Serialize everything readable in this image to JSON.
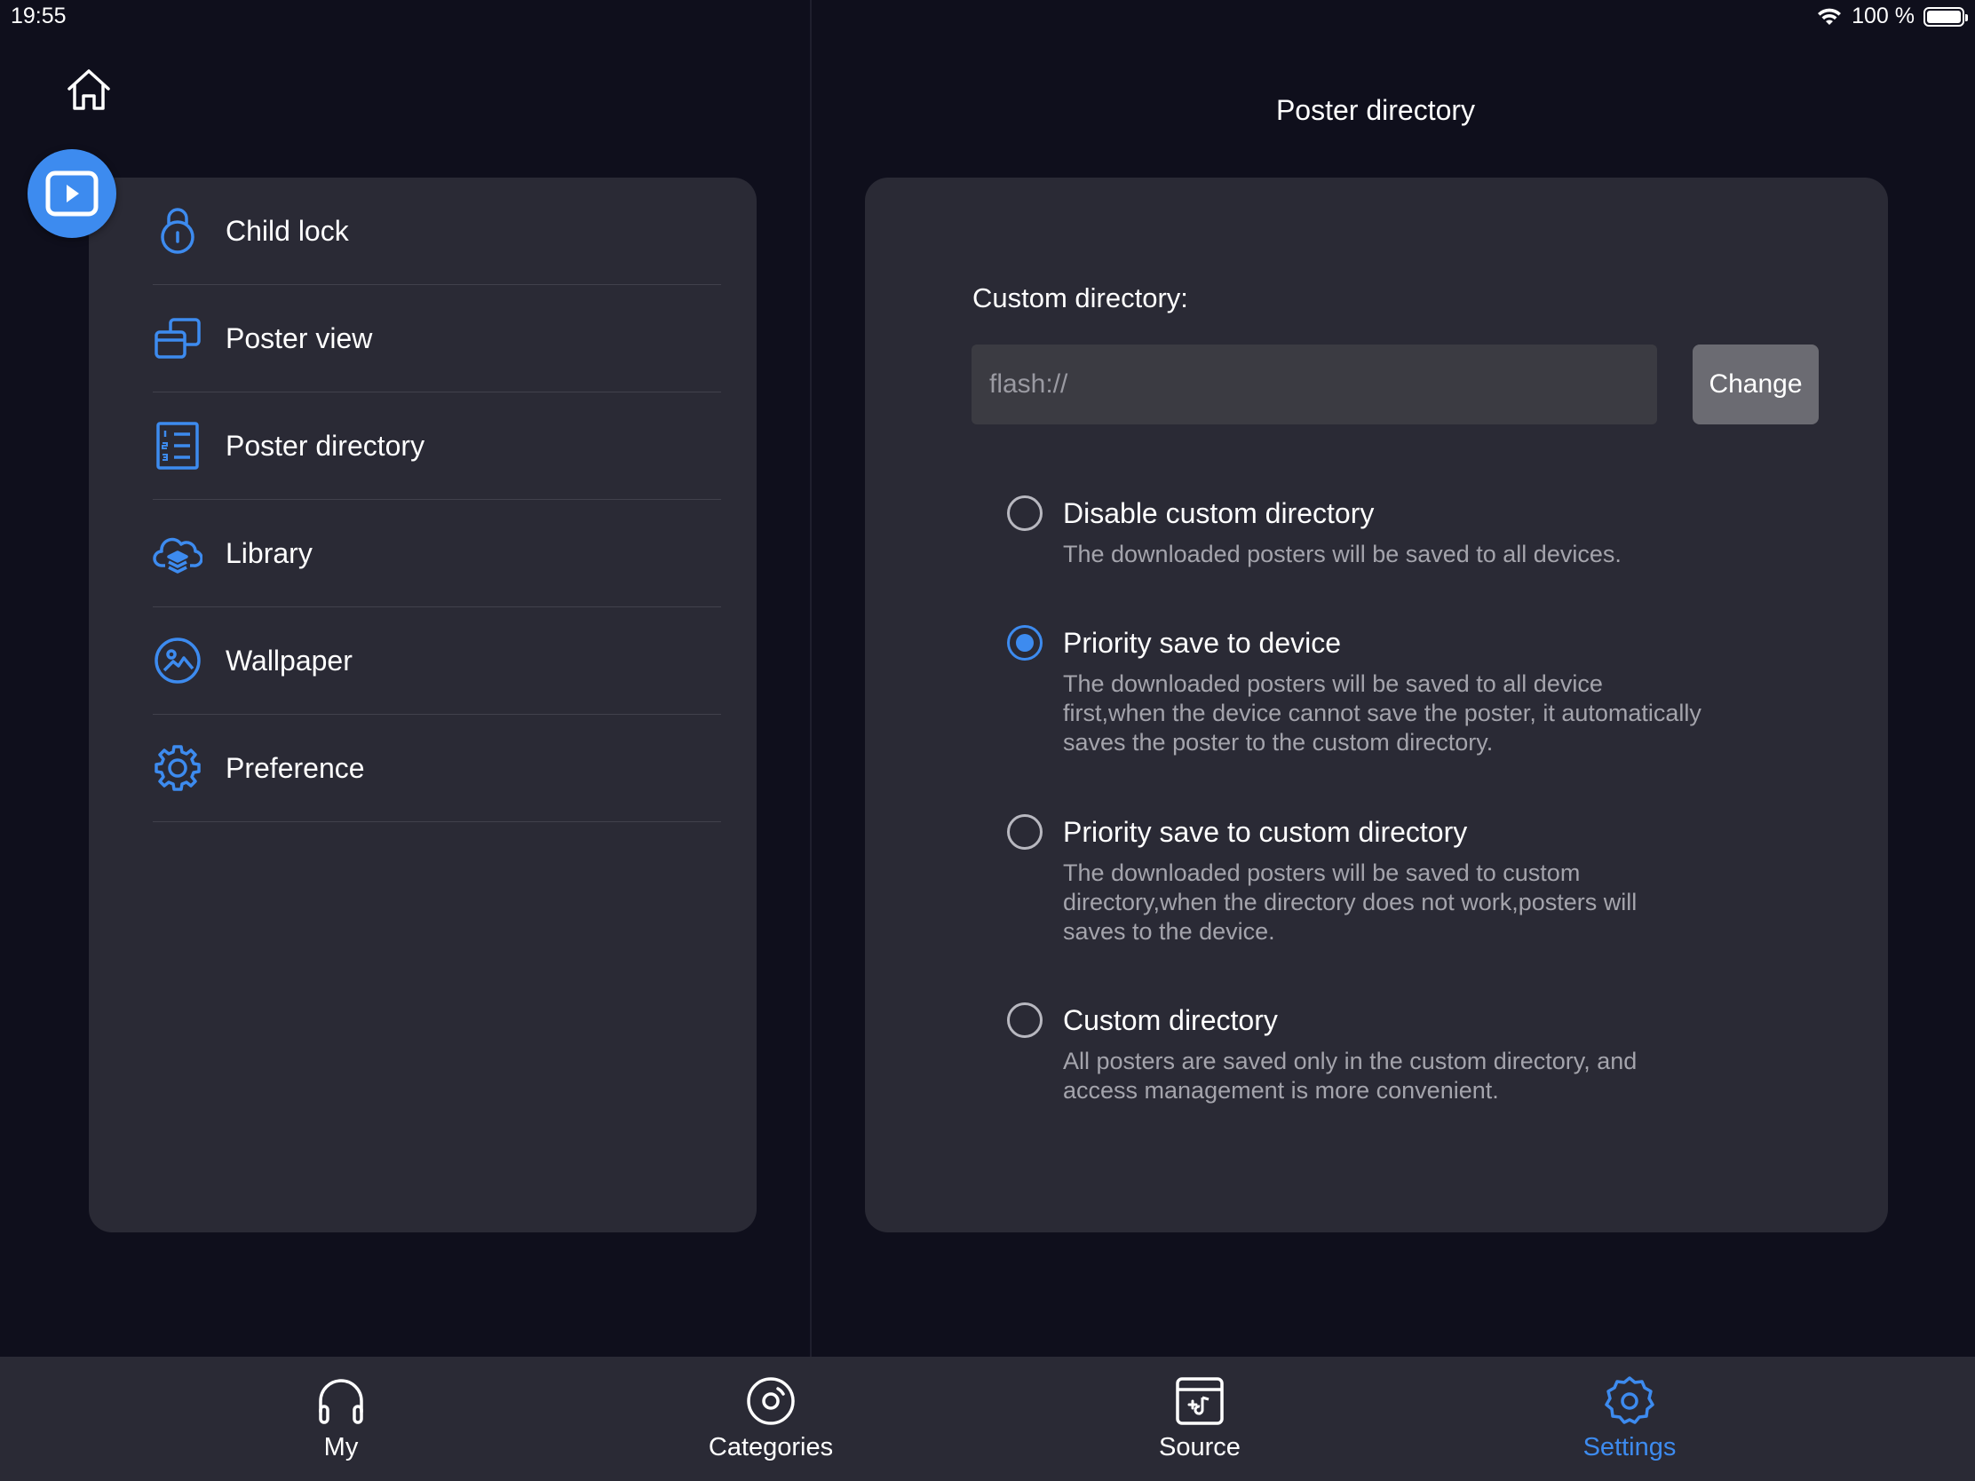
{
  "status_bar": {
    "time": "19:55",
    "battery": "100 %",
    "icons": [
      "wifi-icon",
      "battery-icon"
    ]
  },
  "colors": {
    "background": "#0f0f1c",
    "card": "#2a2a35",
    "accent": "#3d8bef",
    "text_secondary": "#a4a4ac",
    "input_bg": "#3b3b42",
    "button_bg": "#6b6b72"
  },
  "header": {
    "home_icon": "home-icon",
    "play_icon": "play-icon"
  },
  "sidebar": {
    "items": [
      {
        "label": "Child lock",
        "icon": "lock-icon"
      },
      {
        "label": "Poster view",
        "icon": "poster-view-icon"
      },
      {
        "label": "Poster directory",
        "icon": "numbered-list-icon"
      },
      {
        "label": "Library",
        "icon": "cloud-stack-icon"
      },
      {
        "label": "Wallpaper",
        "icon": "image-icon"
      },
      {
        "label": "Preference",
        "icon": "gear-icon"
      }
    ]
  },
  "main": {
    "title": "Poster directory",
    "custom_directory_label": "Custom directory:",
    "directory_input": {
      "value": "",
      "placeholder": "flash://"
    },
    "change_button": "Change",
    "selected_option": 1,
    "options": [
      {
        "title": "Disable custom directory",
        "description": "The downloaded posters will be saved to all devices.",
        "checked": false
      },
      {
        "title": "Priority save to device",
        "description": "The downloaded posters will be saved to all device first,when the device cannot save the poster, it automatically saves the poster to the custom directory.",
        "checked": true
      },
      {
        "title": "Priority save to custom directory",
        "description": "The downloaded posters will be saved to custom directory,when the directory does not work,posters will saves to the device.",
        "checked": false
      },
      {
        "title": "Custom directory",
        "description": "All posters are saved only in the custom directory, and access management is more convenient.",
        "checked": false
      }
    ]
  },
  "tabbar": {
    "active": "Settings",
    "tabs": [
      {
        "label": "My",
        "icon": "headphones-icon"
      },
      {
        "label": "Categories",
        "icon": "disc-icon"
      },
      {
        "label": "Source",
        "icon": "music-folder-icon"
      },
      {
        "label": "Settings",
        "icon": "gear-icon"
      }
    ]
  }
}
